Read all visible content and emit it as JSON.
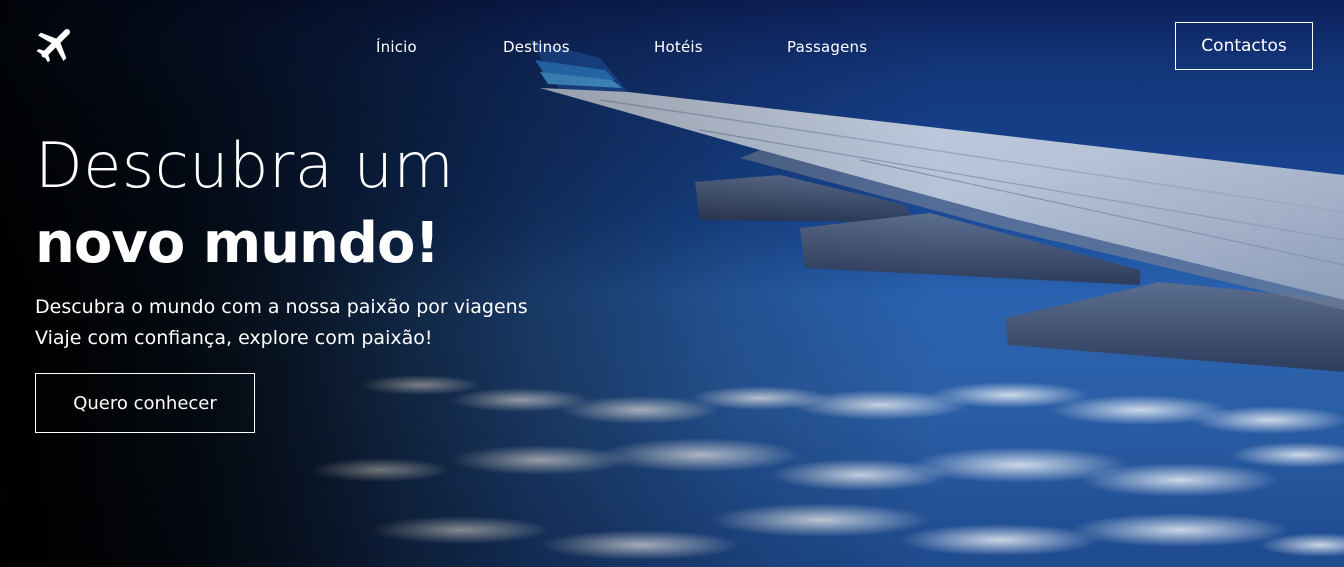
{
  "nav": {
    "logo_icon": "airplane-icon",
    "links": [
      {
        "label": "Ínicio"
      },
      {
        "label": "Destinos"
      },
      {
        "label": "Hotéis"
      },
      {
        "label": "Passagens"
      }
    ],
    "contact_label": "Contactos"
  },
  "hero": {
    "headline_light": "Descubra um",
    "headline_bold": "novo mundo!",
    "subtitle_line1": "Descubra o mundo com a nossa paixão por viagens",
    "subtitle_line2": "Viaje com confiança, explore com paixão!",
    "cta_label": "Quero conhecer",
    "background_image": "airplane-wing-above-clouds"
  },
  "colors": {
    "text": "#ffffff",
    "sky_dark": "#0d2463",
    "sky_light": "#2a63b1"
  }
}
